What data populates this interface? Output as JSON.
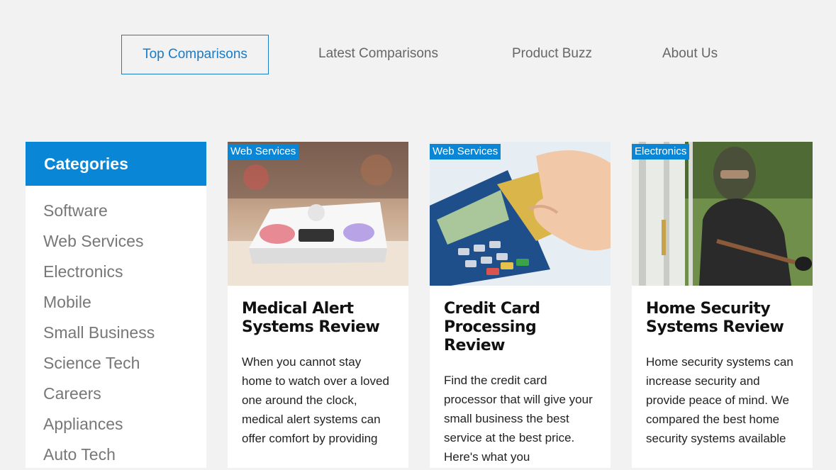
{
  "nav": {
    "items": [
      {
        "label": "Top Comparisons"
      },
      {
        "label": "Latest Comparisons"
      },
      {
        "label": "Product Buzz"
      },
      {
        "label": "About Us"
      }
    ]
  },
  "sidebar": {
    "title": "Categories",
    "items": [
      {
        "label": "Software"
      },
      {
        "label": "Web Services"
      },
      {
        "label": "Electronics"
      },
      {
        "label": "Mobile"
      },
      {
        "label": "Small Business"
      },
      {
        "label": "Science Tech"
      },
      {
        "label": "Careers"
      },
      {
        "label": "Appliances"
      },
      {
        "label": "Auto Tech"
      }
    ]
  },
  "cards": [
    {
      "badge": "Web Services",
      "title": "Medical Alert Systems Review",
      "text": "When you cannot stay home to watch over a loved one around the clock, medical alert systems can offer comfort by providing"
    },
    {
      "badge": "Web Services",
      "title": "Credit Card Processing Review",
      "text": "Find the credit card processor that will give your small business the best service at the best price. Here's what you"
    },
    {
      "badge": "Electronics",
      "title": "Home Security Systems Review",
      "text": "Home security systems can increase security and provide peace of mind. We compared the best home security systems available"
    }
  ],
  "colors": {
    "accent": "#0a86d6",
    "nav_active": "#1a7bc6",
    "background": "#f2f2f2"
  }
}
